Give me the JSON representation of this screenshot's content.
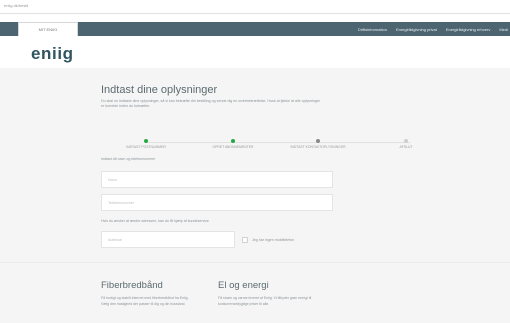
{
  "browser": {
    "address": "eniig.dk/bestil"
  },
  "nav": {
    "tab_label": "MIT ENIIG",
    "links": [
      "Driftsinformation",
      "Energirådgivning privat",
      "Energirådgivning erhverv",
      "Medi"
    ]
  },
  "brand": {
    "logo_text": "eniig"
  },
  "form": {
    "title": "Indtast dine oplysninger",
    "intro": "Du skal nu indtaste dine oplysninger, så vi kan bekræfte din bestilling og sende dig en ordrebekræftelse. Husk at tjekke at alle oplysninger er korrekte inden du fortsætter.",
    "steps": [
      {
        "label": "INDTAST POSTNUMMER",
        "state": "done"
      },
      {
        "label": "OPRET ABONNEMENTER",
        "state": "done"
      },
      {
        "label": "INDTAST KONTAKTOPLYSNINGER",
        "state": "current"
      },
      {
        "label": "AFSLUT",
        "state": "pending"
      }
    ],
    "name_section_label": "Indtast dit navn og telefonnummer",
    "name_placeholder": "Navn",
    "phone_placeholder": "Telefonnummer",
    "address_section_label": "Hvis du ønsker at ændre adressen, kan du få hjælp af kundeservice",
    "address_placeholder": "Adresse",
    "checkbox_label": "Jeg har ingen mobiltelefon"
  },
  "cards": [
    {
      "title": "Fiberbredbånd",
      "text": "Få hurtigt og stabilt internet med fiberbredbånd fra Eniig. Vælg den hastighed der passer til dig og din husstand."
    },
    {
      "title": "El og energi",
      "text": "Få strøm og varme leveret af Eniig. Vi tilbyder grøn energi til konkurrencedygtige priser til alle."
    }
  ]
}
